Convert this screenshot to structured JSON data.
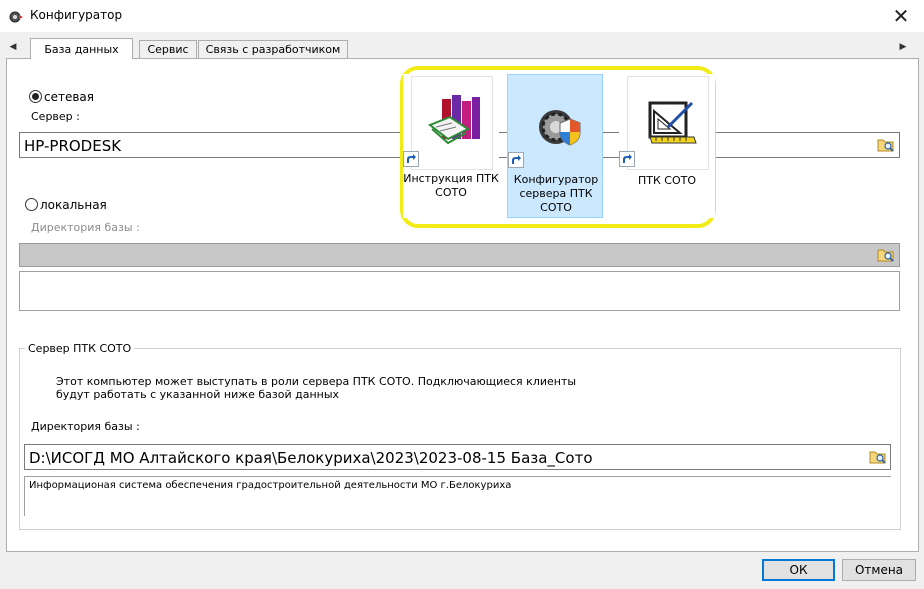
{
  "window": {
    "title": "Конфигуратор",
    "close_glyph": "✕"
  },
  "tabs": [
    {
      "label": "База данных",
      "active": true
    },
    {
      "label": "Сервис",
      "active": false
    },
    {
      "label": "Связь с разработчиком",
      "active": false
    }
  ],
  "database": {
    "network_label": "сетевая",
    "network_selected": true,
    "server_label": "Сервер :",
    "server_value": "HP-PRODESK",
    "local_label": "локальная",
    "local_selected": false,
    "dbdir_label": "Директория базы :"
  },
  "server_group": {
    "title": "Сервер ПТК СОТО",
    "desc_line1": "Этот компьютер может выступать в роли сервера ПТК СОТО. Подключающиеся клиенты",
    "desc_line2": "будут работать с указанной ниже базой данных",
    "dir_label": "Директория базы :",
    "dir_value": "D:\\ИСОГД МО Алтайского края\\Белокуриха\\2023\\2023-08-15 База_Сото",
    "dir_description": "Информационая система обеспечения градостроительной деятельности МО г.Белокуриха"
  },
  "buttons": {
    "ok": "ОК",
    "cancel": "Отмена"
  },
  "shortcuts": [
    {
      "label": "Инструкция ПТК СОТО",
      "icon": "books-icon",
      "selected": false
    },
    {
      "label": "Конфигуратор сервера ПТК СОТО",
      "icon": "gear-shield-icon",
      "selected": true
    },
    {
      "label": "ПТК СОТО",
      "icon": "drafting-icon",
      "selected": false
    }
  ],
  "colors": {
    "highlight": "#f1ec16",
    "selection": "#cce8ff",
    "ok_border": "#0078d7"
  }
}
